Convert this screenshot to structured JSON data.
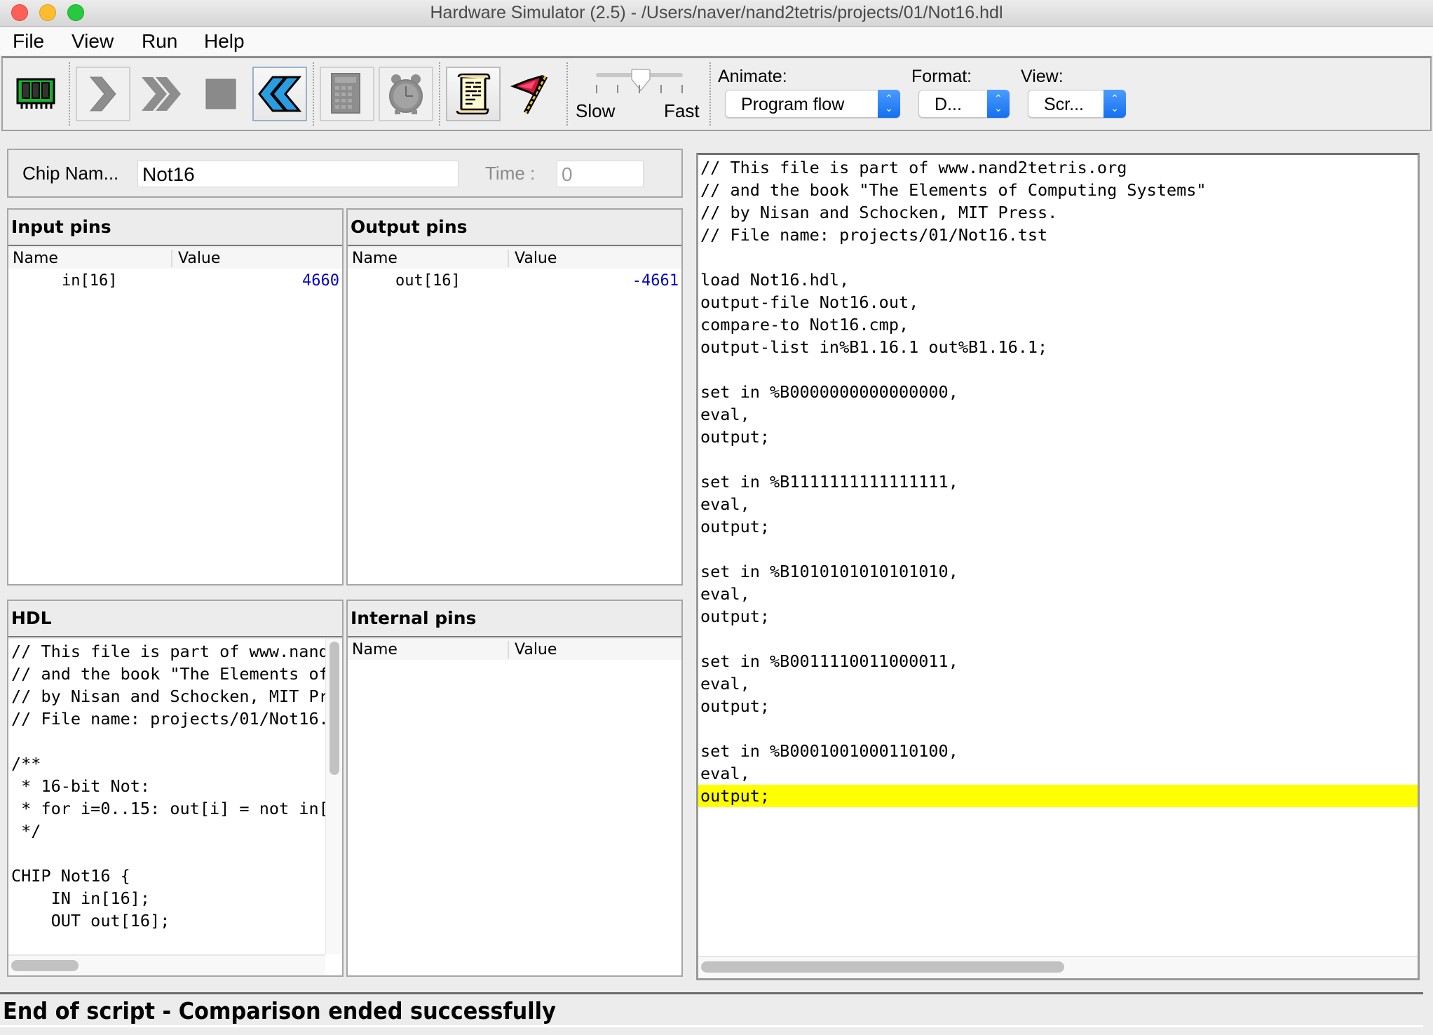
{
  "window": {
    "title": "Hardware Simulator (2.5) - /Users/naver/nand2tetris/projects/01/Not16.hdl"
  },
  "menu": {
    "items": [
      {
        "label": "File"
      },
      {
        "label": "View"
      },
      {
        "label": "Run"
      },
      {
        "label": "Help"
      }
    ]
  },
  "toolbar": {
    "buttons": [
      {
        "name": "load-chip",
        "icon": "chip-icon"
      },
      {
        "name": "single-step",
        "icon": "step-arrow-icon"
      },
      {
        "name": "run",
        "icon": "fast-forward-icon"
      },
      {
        "name": "stop",
        "icon": "stop-square-icon"
      },
      {
        "name": "reset",
        "icon": "rewind-icon"
      },
      {
        "name": "eval",
        "icon": "calculator-icon"
      },
      {
        "name": "tick-tock",
        "icon": "alarm-clock-icon"
      },
      {
        "name": "load-script",
        "icon": "script-scroll-icon"
      },
      {
        "name": "breakpoints",
        "icon": "flag-icon"
      }
    ],
    "speed": {
      "slow_label": "Slow",
      "fast_label": "Fast",
      "value": 0.4
    },
    "animate": {
      "label": "Animate:",
      "value": "Program flow"
    },
    "format": {
      "label": "Format:",
      "value": "D..."
    },
    "view": {
      "label": "View:",
      "value": "Scr..."
    }
  },
  "chip": {
    "name_label": "Chip Nam...",
    "name_value": "Not16",
    "time_label": "Time :",
    "time_value": "0"
  },
  "input_pins": {
    "title": "Input pins",
    "columns": [
      "Name",
      "Value"
    ],
    "rows": [
      {
        "name": "in[16]",
        "value": "4660"
      }
    ]
  },
  "output_pins": {
    "title": "Output pins",
    "columns": [
      "Name",
      "Value"
    ],
    "rows": [
      {
        "name": "out[16]",
        "value": "-4661"
      }
    ]
  },
  "hdl": {
    "title": "HDL",
    "lines": [
      "// This file is part of www.nand",
      "// and the book \"The Elements of",
      "// by Nisan and Schocken, MIT Pr",
      "// File name: projects/01/Not16.",
      "",
      "/**",
      " * 16-bit Not:",
      " * for i=0..15: out[i] = not in[",
      " */",
      "",
      "CHIP Not16 {",
      "    IN in[16];",
      "    OUT out[16];"
    ]
  },
  "internal_pins": {
    "title": "Internal pins",
    "columns": [
      "Name",
      "Value"
    ],
    "rows": []
  },
  "script": {
    "highlighted_line": 28,
    "lines": [
      "// This file is part of www.nand2tetris.org",
      "// and the book \"The Elements of Computing Systems\"",
      "// by Nisan and Schocken, MIT Press.",
      "// File name: projects/01/Not16.tst",
      "",
      "load Not16.hdl,",
      "output-file Not16.out,",
      "compare-to Not16.cmp,",
      "output-list in%B1.16.1 out%B1.16.1;",
      "",
      "set in %B0000000000000000,",
      "eval,",
      "output;",
      "",
      "set in %B1111111111111111,",
      "eval,",
      "output;",
      "",
      "set in %B1010101010101010,",
      "eval,",
      "output;",
      "",
      "set in %B0011110011000011,",
      "eval,",
      "output;",
      "",
      "set in %B0001001000110100,",
      "eval,",
      "output;"
    ]
  },
  "status": {
    "message": "End of script - Comparison ended successfully"
  },
  "colors": {
    "highlight": "#ffff00",
    "pin_value": "#0000c8",
    "combo_accent": "#1570ef"
  }
}
